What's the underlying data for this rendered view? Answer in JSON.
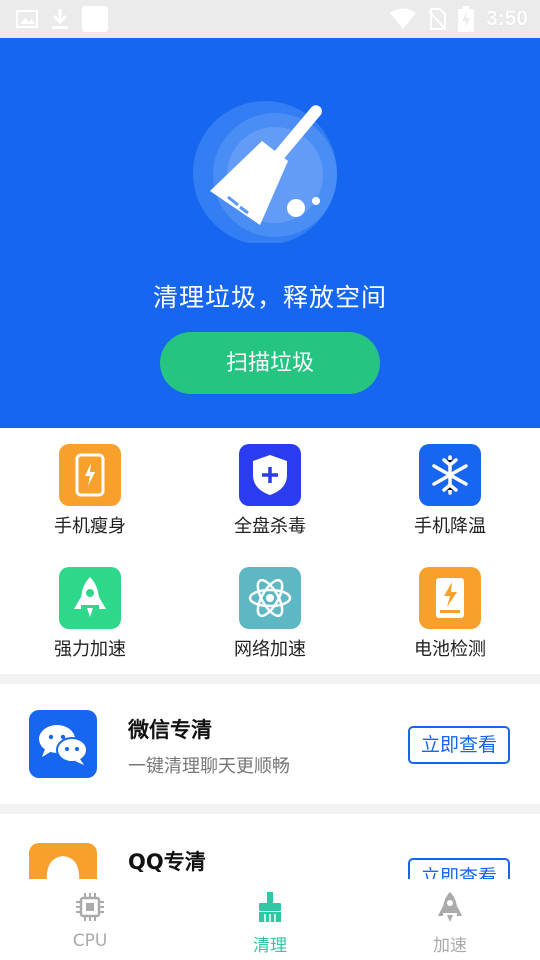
{
  "status_bar": {
    "time": "3:50",
    "left_icons": [
      "image-icon",
      "download-icon",
      "app-square-icon"
    ],
    "right_icons": [
      "wifi-icon",
      "no-sim-icon",
      "battery-charging-icon"
    ]
  },
  "hero": {
    "title": "清理垃圾，释放空间",
    "scan_button": "扫描垃圾",
    "icon": "broom-icon",
    "colors": {
      "background": "#1766f0",
      "button": "#26c481"
    }
  },
  "tools": [
    {
      "label": "手机瘦身",
      "icon": "phone-slim-icon",
      "color": "#f7a02c"
    },
    {
      "label": "全盘杀毒",
      "icon": "shield-plus-icon",
      "color": "#2b3cf0"
    },
    {
      "label": "手机降温",
      "icon": "snowflake-icon",
      "color": "#1766f0"
    },
    {
      "label": "强力加速",
      "icon": "rocket-icon",
      "color": "#2ed88a"
    },
    {
      "label": "网络加速",
      "icon": "atom-icon",
      "color": "#5eb8c4"
    },
    {
      "label": "电池检测",
      "icon": "battery-bolt-icon",
      "color": "#f7a02c"
    }
  ],
  "cards": [
    {
      "title": "微信专清",
      "subtitle": "一键清理聊天更顺畅",
      "button": "立即查看",
      "icon": "wechat-icon",
      "color": "#1766f0"
    },
    {
      "title": "QQ专清",
      "subtitle": "",
      "button": "立即查看",
      "icon": "qq-icon",
      "color": "#f7a02c"
    }
  ],
  "tabbar": {
    "tabs": [
      {
        "label": "CPU",
        "icon": "cpu-chip-icon",
        "active": false
      },
      {
        "label": "清理",
        "icon": "clean-brush-icon",
        "active": true
      },
      {
        "label": "加速",
        "icon": "rocket-icon",
        "active": false
      }
    ],
    "colors": {
      "active": "#2ec9a4",
      "inactive": "#aaaaaa"
    }
  }
}
